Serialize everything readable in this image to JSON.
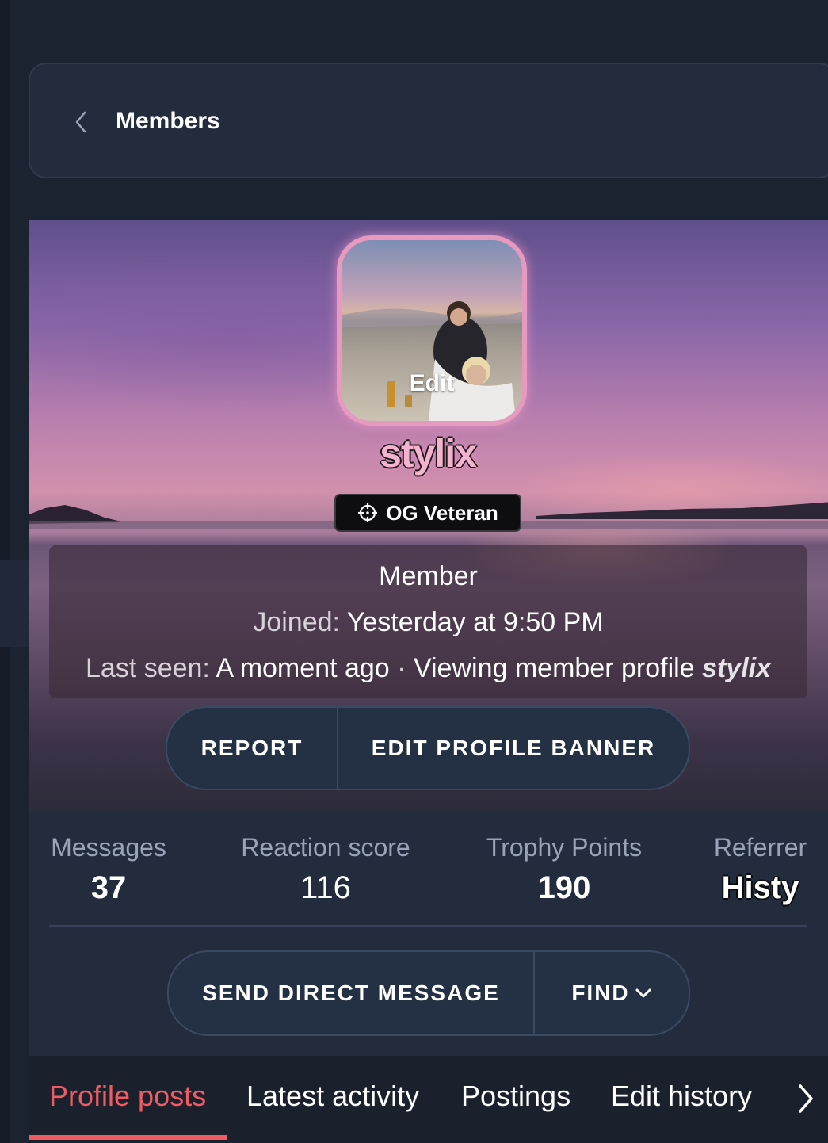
{
  "breadcrumb": {
    "label": "Members"
  },
  "profile": {
    "avatar_action": "Edit",
    "username": "stylix",
    "badge": {
      "icon": "crosshair-icon",
      "label": "OG Veteran"
    },
    "role": "Member",
    "joined_label": "Joined:",
    "joined_value": "Yesterday at 9:50 PM",
    "last_seen_label": "Last seen:",
    "last_seen_value": "A moment ago",
    "separator": "·",
    "activity_text": "Viewing member profile",
    "activity_link": "stylix"
  },
  "actions_top": {
    "report": "REPORT",
    "edit_banner": "EDIT PROFILE BANNER"
  },
  "stats": [
    {
      "label": "Messages",
      "value": "37"
    },
    {
      "label": "Reaction score",
      "value": "116"
    },
    {
      "label": "Trophy Points",
      "value": "190"
    },
    {
      "label": "Referrer",
      "value": "Histy"
    }
  ],
  "actions_bottom": {
    "dm": "SEND DIRECT MESSAGE",
    "find": "FIND"
  },
  "tabs": [
    {
      "label": "Profile posts",
      "active": true
    },
    {
      "label": "Latest activity",
      "active": false
    },
    {
      "label": "Postings",
      "active": false
    },
    {
      "label": "Edit history",
      "active": false
    }
  ],
  "colors": {
    "accent": "#ef5b63",
    "username": "#f6b3cf",
    "avatar_border": "#e79ac0",
    "background": "#1b2230",
    "card": "#232c3d"
  }
}
